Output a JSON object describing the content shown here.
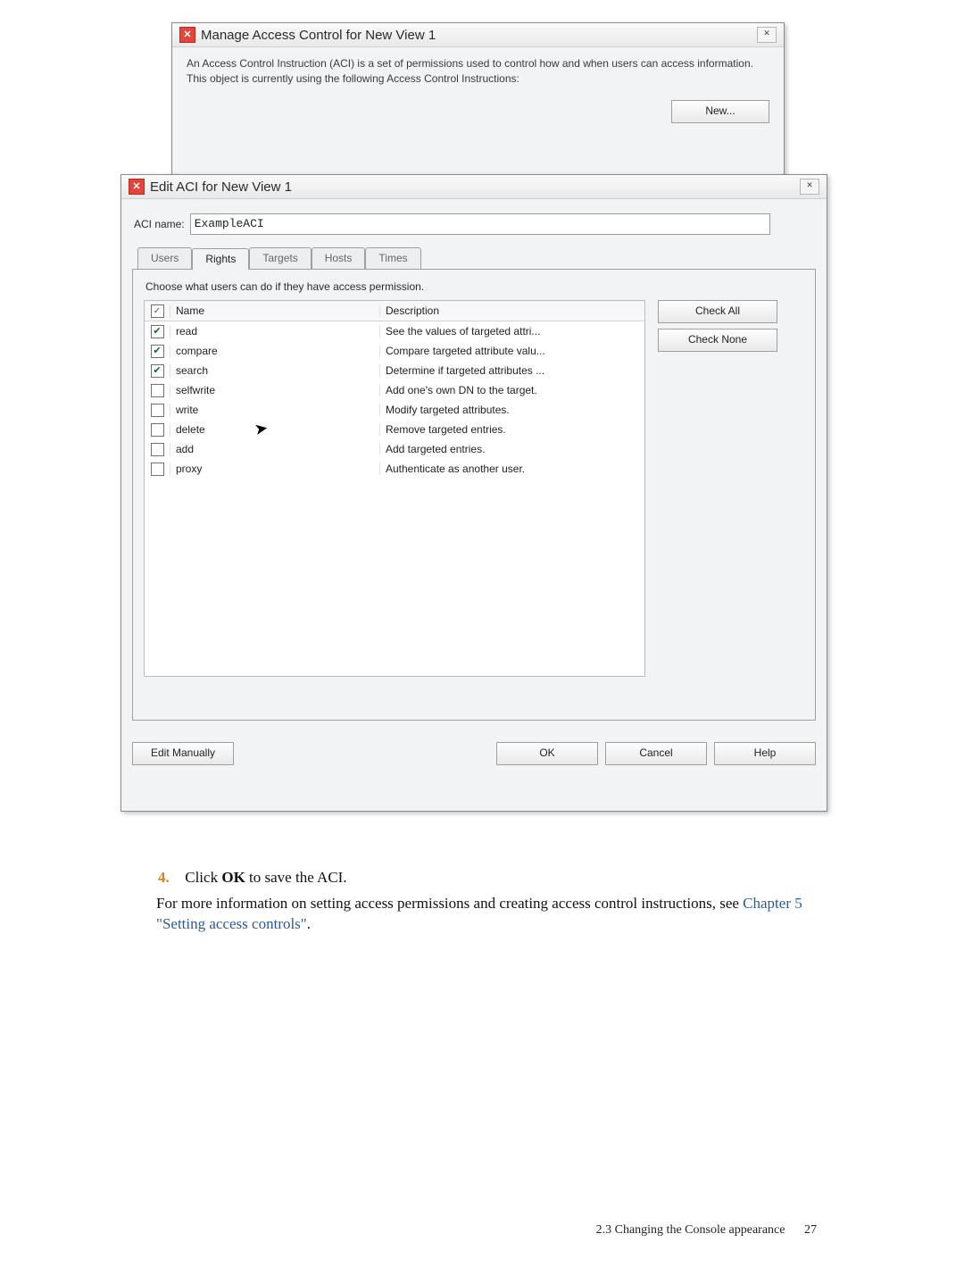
{
  "manage_dialog": {
    "title": "Manage Access Control for New View 1",
    "desc": "An Access Control Instruction (ACI) is a set of permissions used to control how and when users can access information. This object is currently using the following Access Control Instructions:",
    "new_btn": "New..."
  },
  "edit_dialog": {
    "title": "Edit ACI for New View 1",
    "aci_label": "ACI name:",
    "aci_value": "ExampleACI",
    "tabs": [
      "Users",
      "Rights",
      "Targets",
      "Hosts",
      "Times"
    ],
    "active_tab": 1,
    "instruction": "Choose what users can do if they have access permission.",
    "headers": {
      "name": "Name",
      "desc": "Description"
    },
    "rows": [
      {
        "checked": true,
        "name": "read",
        "desc": "See the values of targeted attri..."
      },
      {
        "checked": true,
        "name": "compare",
        "desc": "Compare targeted attribute valu..."
      },
      {
        "checked": true,
        "name": "search",
        "desc": "Determine if targeted attributes ..."
      },
      {
        "checked": false,
        "name": "selfwrite",
        "desc": "Add one's own DN to the target."
      },
      {
        "checked": false,
        "name": "write",
        "desc": "Modify targeted attributes."
      },
      {
        "checked": false,
        "name": "delete",
        "desc": "Remove targeted entries."
      },
      {
        "checked": false,
        "name": "add",
        "desc": "Add targeted entries."
      },
      {
        "checked": false,
        "name": "proxy",
        "desc": "Authenticate as another user."
      }
    ],
    "check_all": "Check All",
    "check_none": "Check None",
    "edit_manually": "Edit Manually",
    "ok": "OK",
    "cancel": "Cancel",
    "help": "Help"
  },
  "doc": {
    "step4_prefix": "Click ",
    "step4_bold": "OK",
    "step4_suffix": " to save the ACI.",
    "para_prefix": "For more information on setting access permissions and creating access control instructions, see ",
    "para_link": "Chapter 5 \"Setting access controls\"",
    "para_suffix": "."
  },
  "footer": {
    "section": "2.3 Changing the Console appearance",
    "page": "27"
  }
}
